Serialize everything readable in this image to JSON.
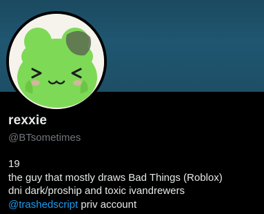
{
  "profile": {
    "display_name": "rexxie",
    "handle": "@BTsometimes",
    "avatar_icon": "green-frog-hat-avatar",
    "bio": {
      "line1": "19",
      "line2": "the guy that mostly draws Bad Things (Roblox)",
      "line3": "dni dark/proship and toxic ivandrewers",
      "mention": "@trashedscript",
      "line4_rest": " priv account"
    }
  },
  "colors": {
    "background": "#000000",
    "banner": "#1f5670",
    "text_primary": "#e7e9ea",
    "text_secondary": "#71767b",
    "link": "#1d9bf0",
    "avatar_green": "#7ed957"
  }
}
